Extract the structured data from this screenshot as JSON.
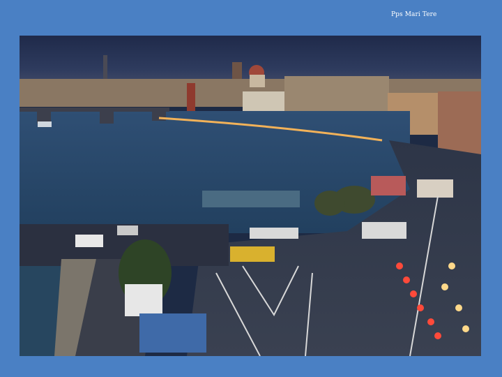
{
  "slide": {
    "caption": "Pps Mari Tere",
    "background_color": "#4a80c4"
  },
  "photo": {
    "subject": "city-night-river-photo"
  }
}
